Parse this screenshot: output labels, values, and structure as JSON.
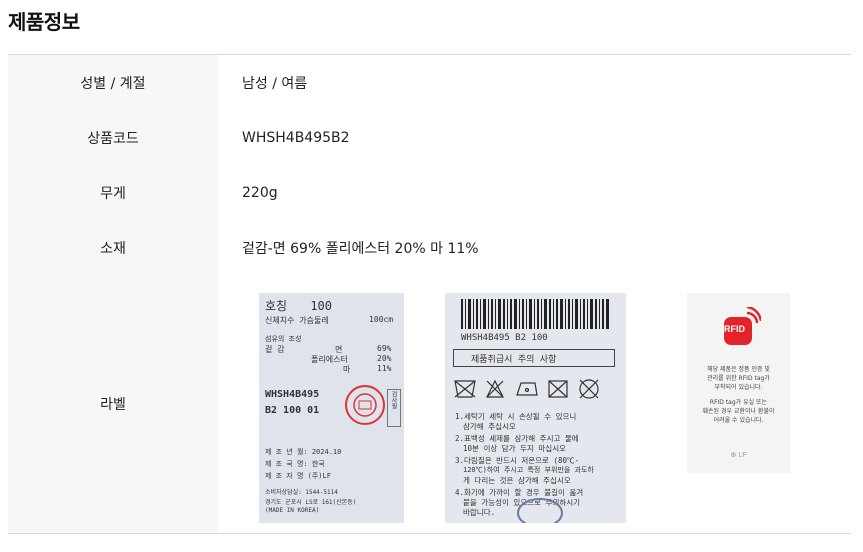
{
  "title": "제품정보",
  "rows": [
    {
      "label": "성별 / 계절",
      "value": "남성 / 여름"
    },
    {
      "label": "상품코드",
      "value": "WHSH4B495B2"
    },
    {
      "label": "무게",
      "value": "220g"
    },
    {
      "label": "소재",
      "value": "겉감-면 69% 폴리에스터 20% 마 11%"
    },
    {
      "label": "라벨",
      "value": ""
    }
  ],
  "label1": {
    "size_title": "호칭",
    "size_value": "100",
    "body_size": "신체치수 가슴둘레",
    "body_size_value": "100cm",
    "fiber": "섬유의 조성",
    "outer": "겉 감",
    "fiber1_name": "면",
    "fiber1_pct": "69%",
    "fiber2_name": "폴리에스터",
    "fiber2_pct": "20%",
    "fiber3_name": "마",
    "fiber3_pct": "11%",
    "code1": "WHSH4B495",
    "code2": "B2 100 01",
    "inspection": "검사필",
    "made_date": "제 조 년 월: 2024.10",
    "made_country": "제 조 국 명: 한국",
    "maker": "제 조 자 명 (주)LF",
    "consumer": "소비자상담실: 1544-5114",
    "address": "경기도 군포시 LS로 161(산본동)",
    "made_in": "(MADE IN KOREA)"
  },
  "label2": {
    "code": "WHSH4B495 B2 100",
    "care_title": "제품취급시 주의 사항",
    "care1": "1.세탁기 세탁 시 손상될 수 있으니",
    "care1b": "삼가해 주십시오",
    "care2": "2.표백성 세제를 삼가해 주시고 물에",
    "care2b": "10분 이상 담가 두지 마십시오",
    "care3": "3.다림질은 반드시 저온으로 (80℃-",
    "care3b": "120℃)하여 주시고 특정 부위만을 과도하",
    "care3c": "게 다리는 것은 삼가해 주십시오",
    "care4": "4.화기에 가까이 할 경우 불길이 옮겨",
    "care4b": "붙을 가능성이 있으므로 주의하시기",
    "care4c": "바랍니다."
  },
  "label3": {
    "rfid": "RFID",
    "text1": "해당 제품은 정품 인증 및",
    "text2": "관리를 위한 RFID tag가",
    "text3": "부착되어 있습니다.",
    "text4": "RFID tag가 유실 또는",
    "text5": "훼손된 경우 교환이나 환불이",
    "text6": "어려울 수 있습니다.",
    "brand": "LF"
  }
}
